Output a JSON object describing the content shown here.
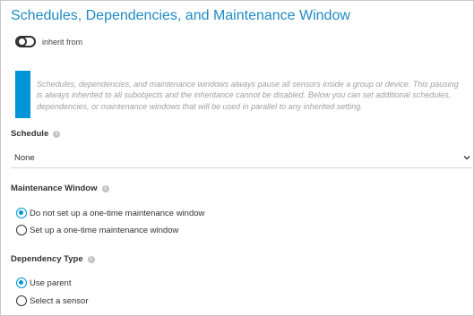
{
  "title": "Schedules, Dependencies, and Maintenance Window",
  "inherit": {
    "label": "inherit from",
    "checked": false
  },
  "info": {
    "text": "Schedules, dependencies, and maintenance windows always pause all sensors inside a group or device. This pausing is always inherited to all subobjects and the inheritance cannot be disabled. Below you can set additional schedules, dependencies, or maintenance windows that will be used in parallel to any inherited setting."
  },
  "schedule": {
    "label": "Schedule",
    "value": "None",
    "icon": "info-icon"
  },
  "maintenance": {
    "label": "Maintenance Window",
    "options": [
      "Do not set up a one-time maintenance window",
      "Set up a one-time maintenance window"
    ],
    "selected_index": 0
  },
  "dependency": {
    "label": "Dependency Type",
    "options": [
      "Use parent",
      "Select a sensor"
    ],
    "selected_index": 0
  },
  "colors": {
    "accent": "#0095d9",
    "title": "#1e8bc3"
  }
}
